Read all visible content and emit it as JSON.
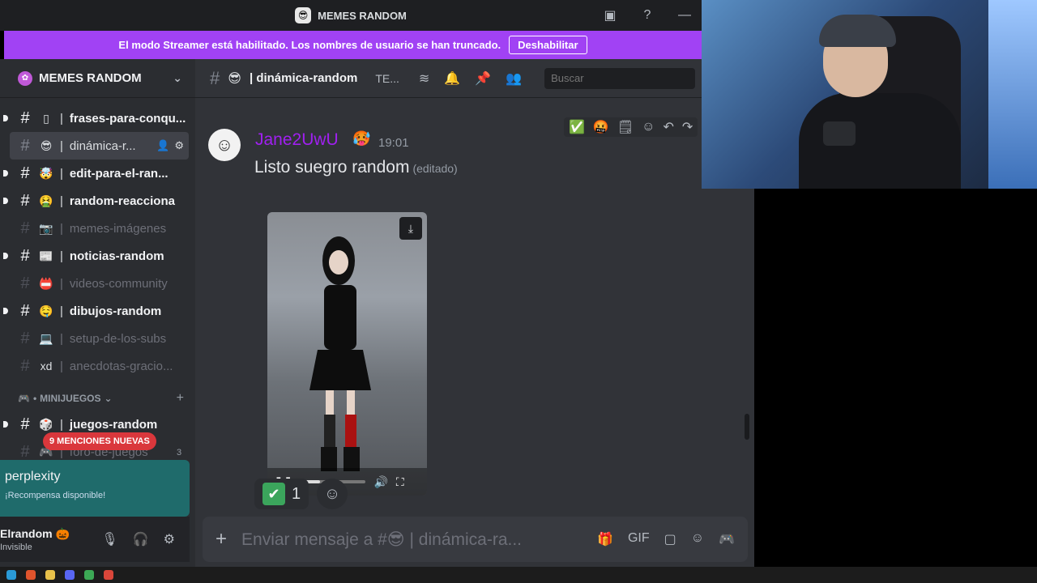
{
  "window": {
    "title": "MEMES RANDOM"
  },
  "banner": {
    "text": "El modo Streamer está habilitado. Los nombres de usuario se han truncado.",
    "button": "Deshabilitar"
  },
  "server": {
    "name": "MEMES RANDOM"
  },
  "channels": [
    {
      "emoji": "▯",
      "name": "frases-para-conqu...",
      "state": "unread"
    },
    {
      "emoji": "😎",
      "name": "dinámica-r...",
      "state": "active"
    },
    {
      "emoji": "🤯",
      "name": "edit-para-el-ran...",
      "state": "unread"
    },
    {
      "emoji": "🤮",
      "name": "random-reacciona",
      "state": "unread"
    },
    {
      "emoji": "📷",
      "name": "memes-imágenes",
      "state": "muted"
    },
    {
      "emoji": "📰",
      "name": "noticias-random",
      "state": "unread"
    },
    {
      "emoji": "📛",
      "name": "videos-community",
      "state": "muted"
    },
    {
      "emoji": "🤤",
      "name": "dibujos-random",
      "state": "unread"
    },
    {
      "emoji": "💻",
      "name": "setup-de-los-subs",
      "state": "muted"
    },
    {
      "emoji": "xd",
      "name": "anecdotas-gracio...",
      "state": "muted"
    }
  ],
  "category": {
    "name": "MINIJUEGOS",
    "icon": "🎮"
  },
  "game_channels": [
    {
      "emoji": "🎲",
      "name": "juegos-random",
      "state": "unread"
    },
    {
      "emoji": "🎮",
      "name": "foro-de-juegos",
      "state": "muted"
    }
  ],
  "mentions": {
    "label": "9 MENCIONES NUEVAS",
    "count": "3"
  },
  "promo": {
    "title": "perplexity",
    "subtitle": "¡Recompensa disponible!"
  },
  "user": {
    "name": "Elrandom 🎃",
    "status": "Invisible"
  },
  "header": {
    "channel_emoji": "😎",
    "channel_name": "dinámica-random",
    "topic": "TE...",
    "search_placeholder": "Buscar"
  },
  "message": {
    "author": "Jane2UwU",
    "author_badge": "🥵",
    "time": "19:01",
    "text": "Listo suegro random",
    "edited": "(editado)",
    "video_progress": 0.3
  },
  "reactions": {
    "check_count": "1"
  },
  "composer": {
    "placeholder": "Enviar mensaje a #😎 | dinámica-ra..."
  },
  "colors": {
    "accent": "#a142f4",
    "author": "#a020f0",
    "mentions": "#da373c",
    "promo": "#1f6b6b"
  }
}
